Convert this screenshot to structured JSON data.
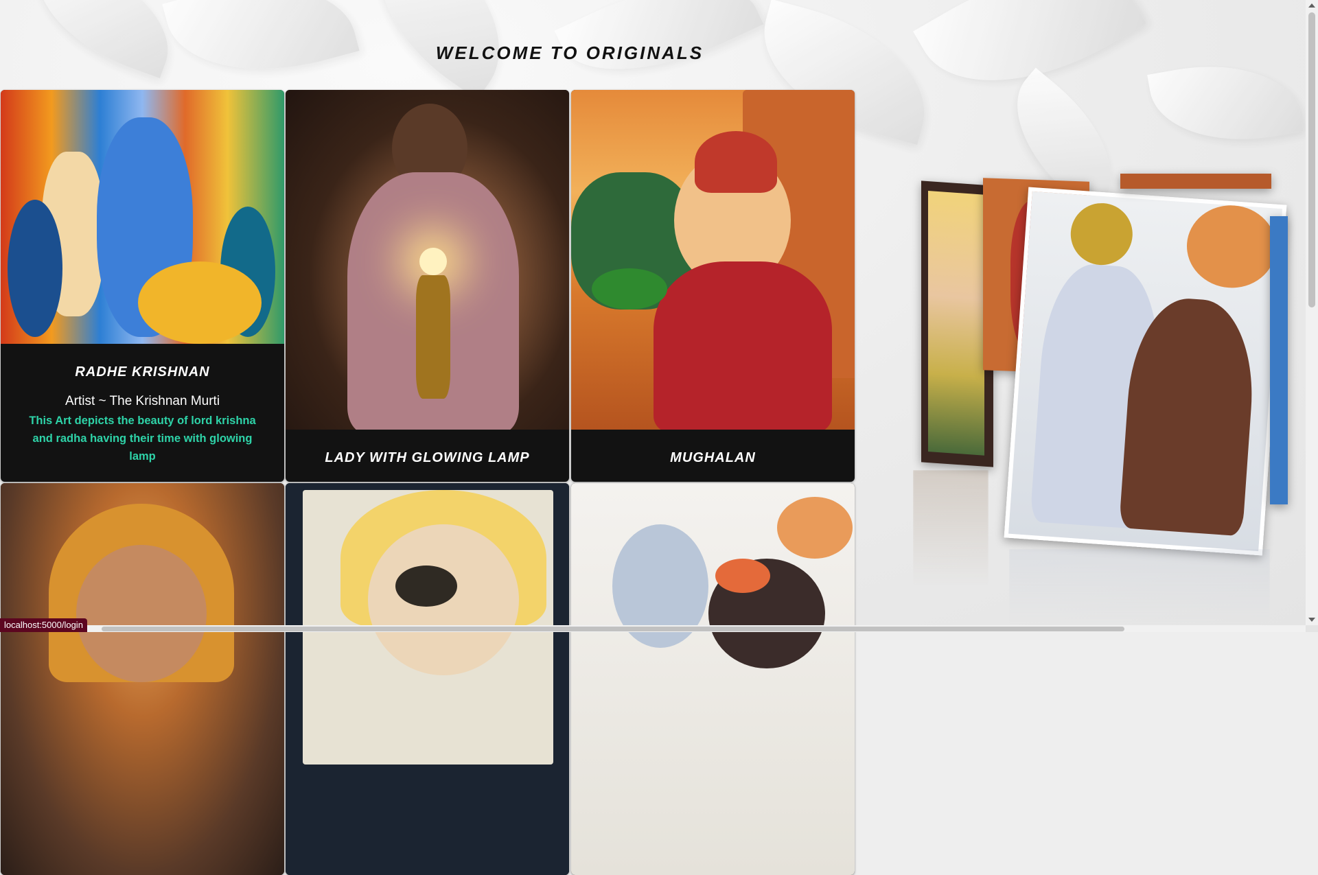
{
  "page": {
    "title": "WELCOME TO ORIGINALS"
  },
  "cards": [
    {
      "title": "RADHE KRISHNAN",
      "artist": "Artist ~ The Krishnan Murti",
      "description": "This Art depicts the beauty of lord krishna and radha having their time with glowing lamp"
    },
    {
      "title": "LADY WITH GLOWING LAMP"
    },
    {
      "title": "MUGHALAN"
    },
    {
      "title": ""
    },
    {
      "title": ""
    },
    {
      "title": ""
    }
  ],
  "status_bar": {
    "url": "localhost:5000/login"
  },
  "colors": {
    "card_bg": "#121212",
    "description": "#2ed3a8",
    "status_bg": "#5c0620"
  }
}
